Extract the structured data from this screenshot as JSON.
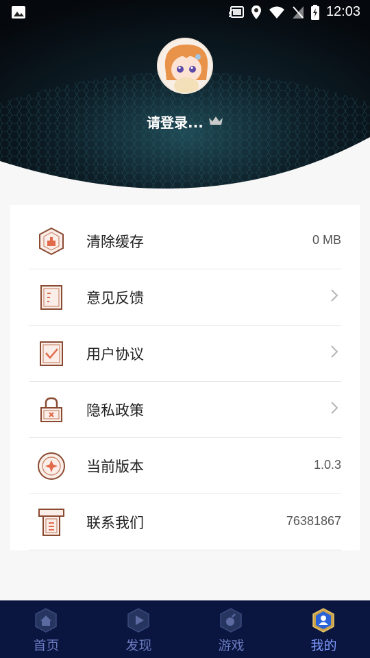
{
  "status_bar": {
    "time": "12:03"
  },
  "profile": {
    "login_text": "请登录..."
  },
  "menu": {
    "items": [
      {
        "label": "清除缓存",
        "value": "0 MB",
        "icon": "broom-hexagon-icon"
      },
      {
        "label": "意见反馈",
        "value": "",
        "icon": "feedback-note-icon"
      },
      {
        "label": "用户协议",
        "value": "",
        "icon": "agreement-check-icon"
      },
      {
        "label": "隐私政策",
        "value": "",
        "icon": "privacy-lock-icon"
      },
      {
        "label": "当前版本",
        "value": "1.0.3",
        "icon": "version-badge-icon"
      },
      {
        "label": "联系我们",
        "value": "76381867",
        "icon": "contact-printer-icon"
      }
    ]
  },
  "bottom_nav": {
    "items": [
      {
        "label": "首页",
        "icon": "home-icon"
      },
      {
        "label": "发现",
        "icon": "play-icon"
      },
      {
        "label": "游戏",
        "icon": "game-icon"
      },
      {
        "label": "我的",
        "icon": "user-icon"
      }
    ],
    "active": "我的"
  },
  "colors": {
    "accent": "#b86a4a",
    "nav_bg": "#0a1540",
    "nav_active": "#7f9cff"
  }
}
